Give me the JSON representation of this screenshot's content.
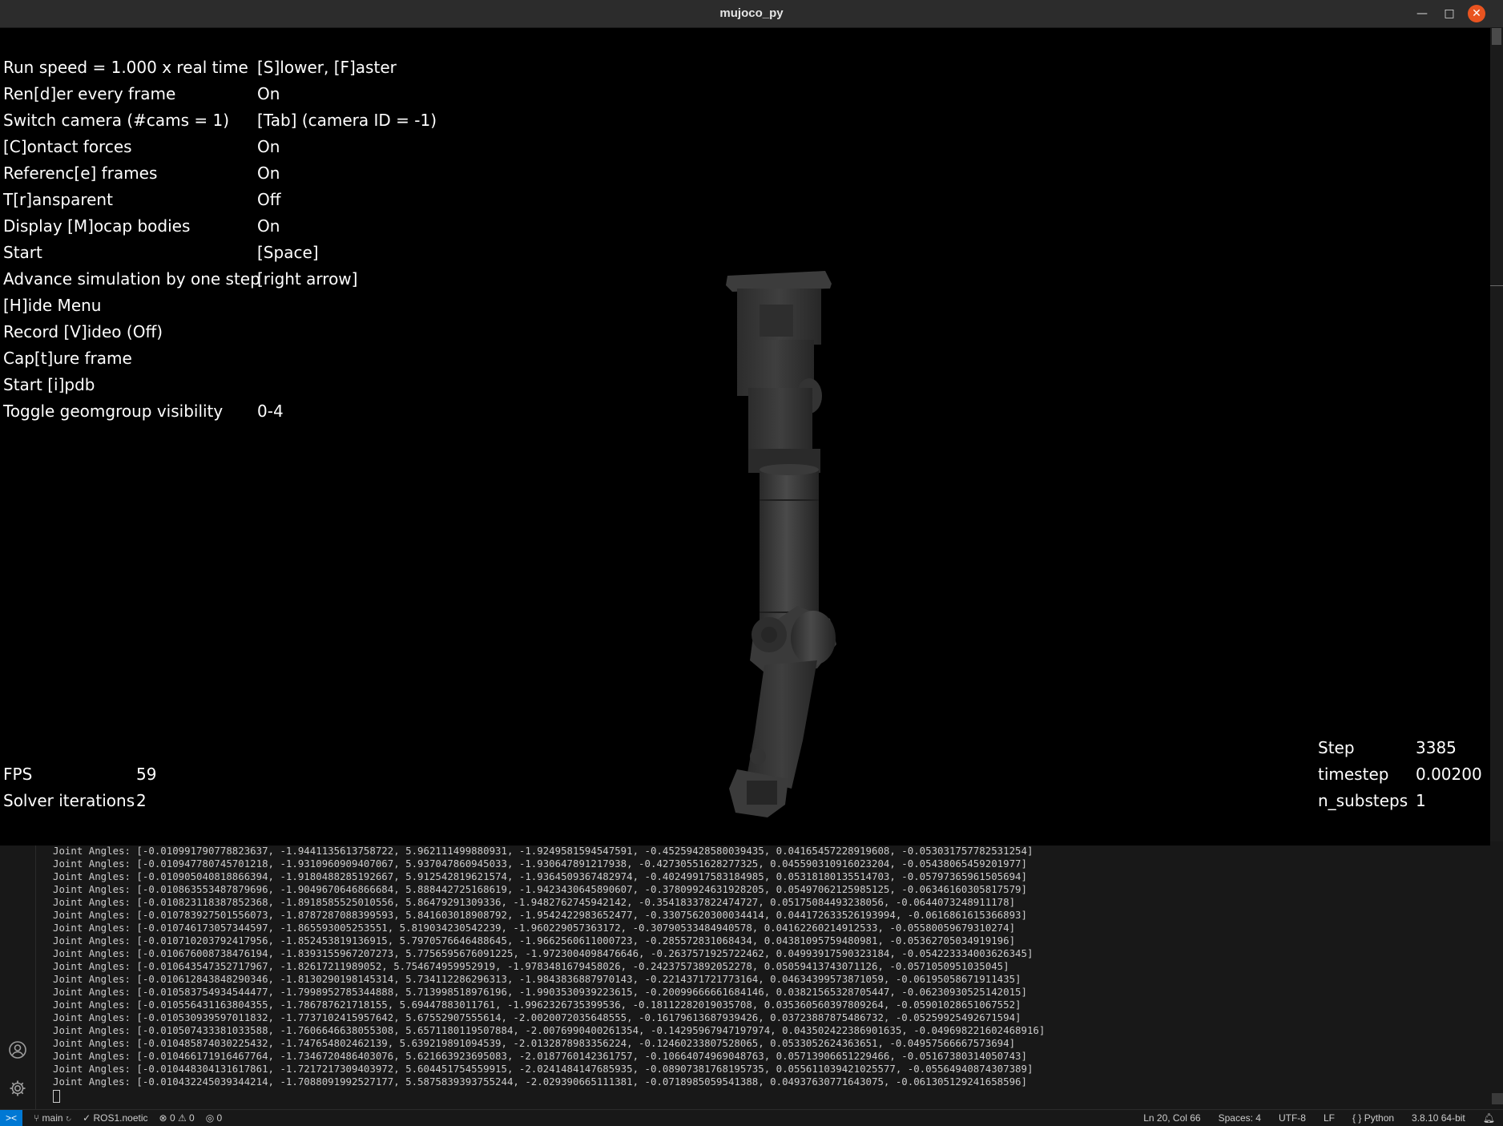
{
  "window": {
    "title": "mujoco_py"
  },
  "menu": [
    {
      "key": "Run speed = 1.000 x real time",
      "value": "[S]lower, [F]aster"
    },
    {
      "key": "Ren[d]er every frame",
      "value": "On"
    },
    {
      "key": "Switch camera (#cams = 1)",
      "value": "[Tab] (camera ID = -1)"
    },
    {
      "key": "[C]ontact forces",
      "value": "On"
    },
    {
      "key": "Referenc[e] frames",
      "value": "On"
    },
    {
      "key": "T[r]ansparent",
      "value": "Off"
    },
    {
      "key": "Display [M]ocap bodies",
      "value": "On"
    },
    {
      "key": "Start",
      "value": "[Space]"
    },
    {
      "key": "Advance simulation by one step",
      "value": "[right arrow]"
    },
    {
      "key": "[H]ide Menu",
      "value": ""
    },
    {
      "key": "Record [V]ideo (Off)",
      "value": ""
    },
    {
      "key": "Cap[t]ure frame",
      "value": ""
    },
    {
      "key": "Start [i]pdb",
      "value": ""
    },
    {
      "key": "Toggle geomgroup visibility",
      "value": "0-4"
    }
  ],
  "stats_left": [
    {
      "label": "FPS",
      "value": "59"
    },
    {
      "label": "Solver iterations",
      "value": "2"
    }
  ],
  "stats_right": [
    {
      "label": "Step",
      "value": "3385"
    },
    {
      "label": "timestep",
      "value": "0.00200"
    },
    {
      "label": "n_substeps",
      "value": "1"
    }
  ],
  "terminal": {
    "lines": [
      "Joint Angles: [-0.010991790778823637, -1.9441135613758722, 5.962111499880931, -1.9249581594547591, -0.45259428580039435, 0.04165457228919608, -0.053031757782531254]",
      "Joint Angles: [-0.010947780745701218, -1.9310960909407067, 5.937047860945033, -1.930647891217938, -0.42730551628277325, 0.045590310916023204, -0.05438065459201977]",
      "Joint Angles: [-0.010905040818866394, -1.9180488285192667, 5.912542819621574, -1.9364509367482974, -0.40249917583184985, 0.05318180135514703, -0.05797365961505694]",
      "Joint Angles: [-0.010863553487879696, -1.9049670646866684, 5.888442725168619, -1.9423430645890607, -0.37809924631928205, 0.05497062125985125, -0.06346160305817579]",
      "Joint Angles: [-0.010823118387852368, -1.8918585525010556, 5.86479291309336, -1.9482762745942142, -0.35418337822474727, 0.05175084493238056, -0.0644073248911178]",
      "Joint Angles: [-0.010783927501556073, -1.8787287088399593, 5.841603018908792, -1.9542422983652477, -0.33075620300034414, 0.044172633526193994, -0.0616861615366893]",
      "Joint Angles: [-0.010746173057344597, -1.865593005253551, 5.819034230542239, -1.960229057363172, -0.30790533484940578, 0.04162260214912533, -0.05580059679310274]",
      "Joint Angles: [-0.010710203792417956, -1.852453819136915, 5.7970576646488645, -1.9662560611000723, -0.285572831068434, 0.04381095759480981, -0.05362705034919196]",
      "Joint Angles: [-0.010676008738476194, -1.8393155967207273, 5.7756595676091225, -1.9723004098476646, -0.2637571925722462, 0.04993917590323184, -0.054223334003626345]",
      "Joint Angles: [-0.010643547352717967, -1.82617211989052, 5.754674959952919, -1.9783481679458026, -0.24237573892052278, 0.05059413743071126, -0.0571050951035045]",
      "Joint Angles: [-0.010612843848290346, -1.8130290198145314, 5.734112286296313, -1.9843836887970143, -0.2214371721773164, 0.04634399573871059, -0.06195058671911435]",
      "Joint Angles: [-0.010583754934544477, -1.7998952785344888, 5.713998518976196, -1.9903530939223615, -0.20099666661684146, 0.03821565328705447, -0.06230930525142015]",
      "Joint Angles: [-0.010556431163804355, -1.786787621718155, 5.69447883011761, -1.9962326735399536, -0.18112282019035708, 0.035360560397809264, -0.05901028651067552]",
      "Joint Angles: [-0.010530939597011832, -1.7737102415957642, 5.67552907555614, -2.0020072035648555, -0.16179613687939426, 0.03723887875486732, -0.05259925492671594]",
      "Joint Angles: [-0.010507433381033588, -1.7606646638055308, 5.6571180119507884, -2.0076990400261354, -0.14295967947197974, 0.043502422386901635, -0.049698221602468916]",
      "Joint Angles: [-0.010485874030225432, -1.747654802462139, 5.639219891094539, -2.0132878983356224, -0.12460233807528065, 0.0533052624363651, -0.04957566667573694]",
      "Joint Angles: [-0.010466171916467764, -1.7346720486403076, 5.621663923695083, -2.0187760142361757, -0.10664074969048763, 0.05713906651229466, -0.05167380314050743]",
      "Joint Angles: [-0.010448304131617861, -1.7217217309403972, 5.604451754559915, -2.0241484147685935, -0.08907381768195735, 0.055611039421025577, -0.05564940874307389]",
      "Joint Angles: [-0.010432245039344214, -1.7088091992527177, 5.5875839393755244, -2.029390665111381, -0.0718985059541388, 0.04937630771643075, -0.061305129241658596]"
    ]
  },
  "statusbar": {
    "branch": "main",
    "ros": "ROS1.noetic",
    "problems": "0 ⚠ 0",
    "ports": "0",
    "position": "Ln 20, Col 66",
    "spaces": "Spaces: 4",
    "encoding": "UTF-8",
    "eol": "LF",
    "language": "Python",
    "interpreter": "3.8.10 64-bit"
  }
}
